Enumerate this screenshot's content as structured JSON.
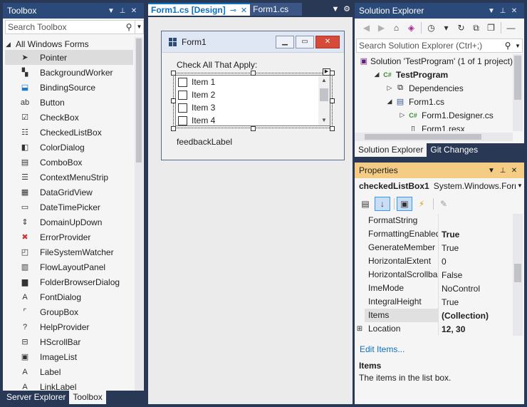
{
  "toolbox": {
    "title": "Toolbox",
    "search_placeholder": "Search Toolbox",
    "group": "All Windows Forms",
    "items": [
      {
        "label": "Pointer",
        "icon": "pointer-icon",
        "glyph": "➤"
      },
      {
        "label": "BackgroundWorker",
        "icon": "background-worker-icon",
        "glyph": "▚"
      },
      {
        "label": "BindingSource",
        "icon": "binding-source-icon",
        "glyph": "⬓"
      },
      {
        "label": "Button",
        "icon": "button-icon",
        "glyph": "ab"
      },
      {
        "label": "CheckBox",
        "icon": "checkbox-icon",
        "glyph": "☑"
      },
      {
        "label": "CheckedListBox",
        "icon": "checked-list-box-icon",
        "glyph": "☷"
      },
      {
        "label": "ColorDialog",
        "icon": "color-dialog-icon",
        "glyph": "◧"
      },
      {
        "label": "ComboBox",
        "icon": "combobox-icon",
        "glyph": "▤"
      },
      {
        "label": "ContextMenuStrip",
        "icon": "context-menu-icon",
        "glyph": "☰"
      },
      {
        "label": "DataGridView",
        "icon": "data-grid-icon",
        "glyph": "▦"
      },
      {
        "label": "DateTimePicker",
        "icon": "date-picker-icon",
        "glyph": "▭"
      },
      {
        "label": "DomainUpDown",
        "icon": "domain-updown-icon",
        "glyph": "⇕"
      },
      {
        "label": "ErrorProvider",
        "icon": "error-provider-icon",
        "glyph": "✖"
      },
      {
        "label": "FileSystemWatcher",
        "icon": "file-watcher-icon",
        "glyph": "◰"
      },
      {
        "label": "FlowLayoutPanel",
        "icon": "flow-layout-icon",
        "glyph": "▥"
      },
      {
        "label": "FolderBrowserDialog",
        "icon": "folder-browser-icon",
        "glyph": "▆"
      },
      {
        "label": "FontDialog",
        "icon": "font-dialog-icon",
        "glyph": "A"
      },
      {
        "label": "GroupBox",
        "icon": "groupbox-icon",
        "glyph": "⌜"
      },
      {
        "label": "HelpProvider",
        "icon": "help-provider-icon",
        "glyph": "?"
      },
      {
        "label": "HScrollBar",
        "icon": "hscrollbar-icon",
        "glyph": "⊟"
      },
      {
        "label": "ImageList",
        "icon": "image-list-icon",
        "glyph": "▣"
      },
      {
        "label": "Label",
        "icon": "label-icon",
        "glyph": "A"
      },
      {
        "label": "LinkLabel",
        "icon": "link-label-icon",
        "glyph": "A"
      }
    ],
    "bottom_tabs": [
      "Server Explorer",
      "Toolbox"
    ]
  },
  "document": {
    "tabs": [
      {
        "label": "Form1.cs [Design]",
        "pin": "⊸",
        "close": "✕"
      },
      {
        "label": "Form1.cs",
        "close": "✕"
      }
    ],
    "form": {
      "title": "Form1",
      "label": "Check All That Apply:",
      "list_items": [
        "Item 1",
        "Item 2",
        "Item 3",
        "Item 4"
      ],
      "feedback": "feedbackLabel"
    }
  },
  "solution_explorer": {
    "title": "Solution Explorer",
    "search_placeholder": "Search Solution Explorer (Ctrl+;)",
    "tree": [
      {
        "label": "Solution 'TestProgram' (1 of 1 project)",
        "indent": 0,
        "exp": "",
        "icon": "solution-icon",
        "glyph": "▣"
      },
      {
        "label": "TestProgram",
        "indent": 1,
        "exp": "◢",
        "icon": "csharp-project-icon",
        "glyph": "C#"
      },
      {
        "label": "Dependencies",
        "indent": 2,
        "exp": "▷",
        "icon": "dependencies-icon",
        "glyph": "⧉"
      },
      {
        "label": "Form1.cs",
        "indent": 2,
        "exp": "◢",
        "icon": "form-file-icon",
        "glyph": "▤"
      },
      {
        "label": "Form1.Designer.cs",
        "indent": 3,
        "exp": "▷",
        "icon": "csharp-file-icon",
        "glyph": "C#"
      },
      {
        "label": "Form1.resx",
        "indent": 3,
        "exp": "",
        "icon": "resx-file-icon",
        "glyph": "▯"
      }
    ],
    "bottom_tabs": [
      "Solution Explorer",
      "Git Changes"
    ]
  },
  "properties": {
    "title": "Properties",
    "object_name": "checkedListBox1",
    "object_type": "System.Windows.Forms.CheckedListBox",
    "rows": [
      {
        "name": "FormatString",
        "value": "",
        "bold": false,
        "exp": ""
      },
      {
        "name": "FormattingEnabled",
        "value": "True",
        "bold": true,
        "exp": ""
      },
      {
        "name": "GenerateMember",
        "value": "True",
        "bold": false,
        "exp": ""
      },
      {
        "name": "HorizontalExtent",
        "value": "0",
        "bold": false,
        "exp": ""
      },
      {
        "name": "HorizontalScrollbar",
        "value": "False",
        "bold": false,
        "exp": ""
      },
      {
        "name": "ImeMode",
        "value": "NoControl",
        "bold": false,
        "exp": ""
      },
      {
        "name": "IntegralHeight",
        "value": "True",
        "bold": false,
        "exp": ""
      },
      {
        "name": "Items",
        "value": "(Collection)",
        "bold": true,
        "exp": ""
      },
      {
        "name": "Location",
        "value": "12, 30",
        "bold": true,
        "exp": "⊞"
      }
    ],
    "command": "Edit Items...",
    "desc_title": "Items",
    "desc_text": "The items in the list box."
  }
}
